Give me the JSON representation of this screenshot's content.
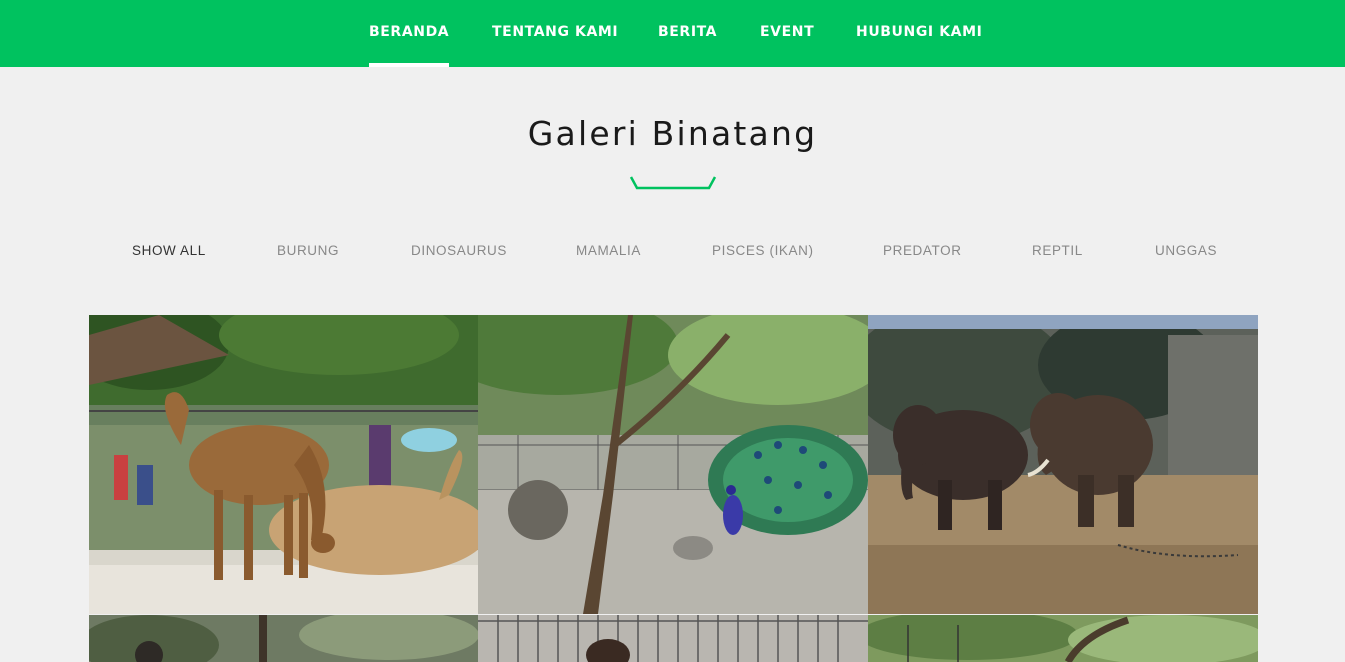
{
  "nav": {
    "items": [
      {
        "label": "BERANDA",
        "active": true
      },
      {
        "label": "TENTANG KAMI",
        "active": false
      },
      {
        "label": "BERITA",
        "active": false
      },
      {
        "label": "EVENT",
        "active": false
      },
      {
        "label": "HUBUNGI KAMI",
        "active": false
      }
    ]
  },
  "gallery": {
    "title": "Galeri Binatang",
    "filters": [
      {
        "label": "SHOW ALL",
        "active": true
      },
      {
        "label": "BURUNG",
        "active": false
      },
      {
        "label": "DINOSAURUS",
        "active": false
      },
      {
        "label": "MAMALIA",
        "active": false
      },
      {
        "label": "PISCES (IKAN)",
        "active": false
      },
      {
        "label": "PREDATOR",
        "active": false
      },
      {
        "label": "REPTIL",
        "active": false
      },
      {
        "label": "UNGGAS",
        "active": false
      }
    ]
  },
  "colors": {
    "brand": "#00c25f",
    "background": "#f0f0f0",
    "filter_active": "#333333",
    "filter_inactive": "#888888"
  }
}
